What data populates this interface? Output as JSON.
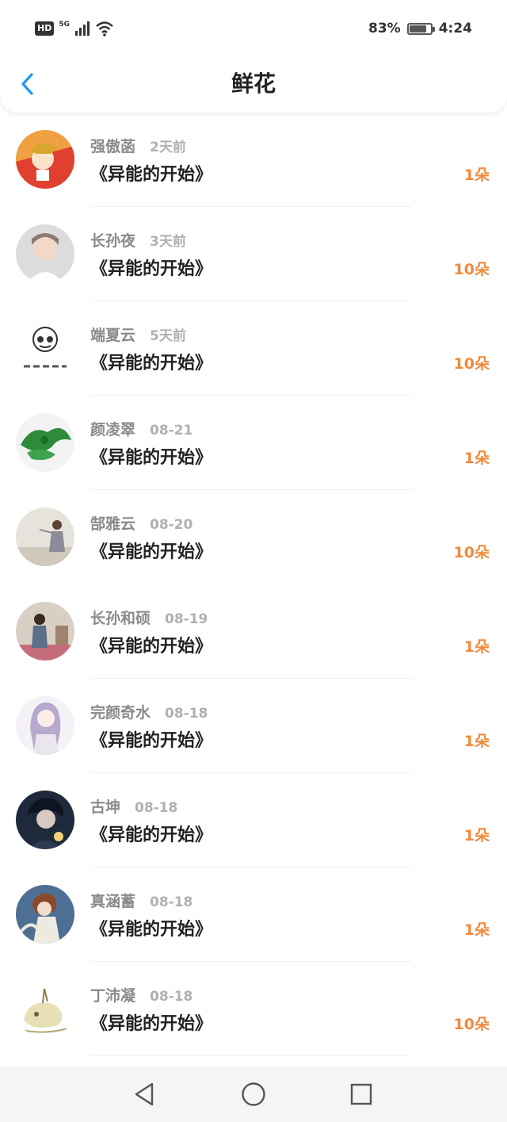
{
  "status_bar": {
    "hd_badge": "HD",
    "network": "5G",
    "battery": "83%",
    "battery_level": 0.83,
    "time": "4:24"
  },
  "header": {
    "title": "鲜花"
  },
  "colors": {
    "accent_blue": "#2196f3",
    "flower_orange": "#f08a3c",
    "name_gray": "#8a8a8a",
    "time_gray": "#b0b0b0"
  },
  "rows": [
    {
      "name": "强傲菡",
      "time": "2天前",
      "book": "《异能的开始》",
      "count": "1朵"
    },
    {
      "name": "长孙夜",
      "time": "3天前",
      "book": "《异能的开始》",
      "count": "10朵"
    },
    {
      "name": "端夏云",
      "time": "5天前",
      "book": "《异能的开始》",
      "count": "10朵"
    },
    {
      "name": "颜凌翠",
      "time": "08-21",
      "book": "《异能的开始》",
      "count": "1朵"
    },
    {
      "name": "郜雅云",
      "time": "08-20",
      "book": "《异能的开始》",
      "count": "10朵"
    },
    {
      "name": "长孙和硕",
      "time": "08-19",
      "book": "《异能的开始》",
      "count": "1朵"
    },
    {
      "name": "完颜奇水",
      "time": "08-18",
      "book": "《异能的开始》",
      "count": "1朵"
    },
    {
      "name": "古坤",
      "time": "08-18",
      "book": "《异能的开始》",
      "count": "1朵"
    },
    {
      "name": "真涵蓄",
      "time": "08-18",
      "book": "《异能的开始》",
      "count": "1朵"
    },
    {
      "name": "丁沛凝",
      "time": "08-18",
      "book": "《异能的开始》",
      "count": "10朵"
    }
  ],
  "nav": {
    "icons": [
      "back-triangle-icon",
      "home-circle-icon",
      "recents-square-icon"
    ]
  }
}
